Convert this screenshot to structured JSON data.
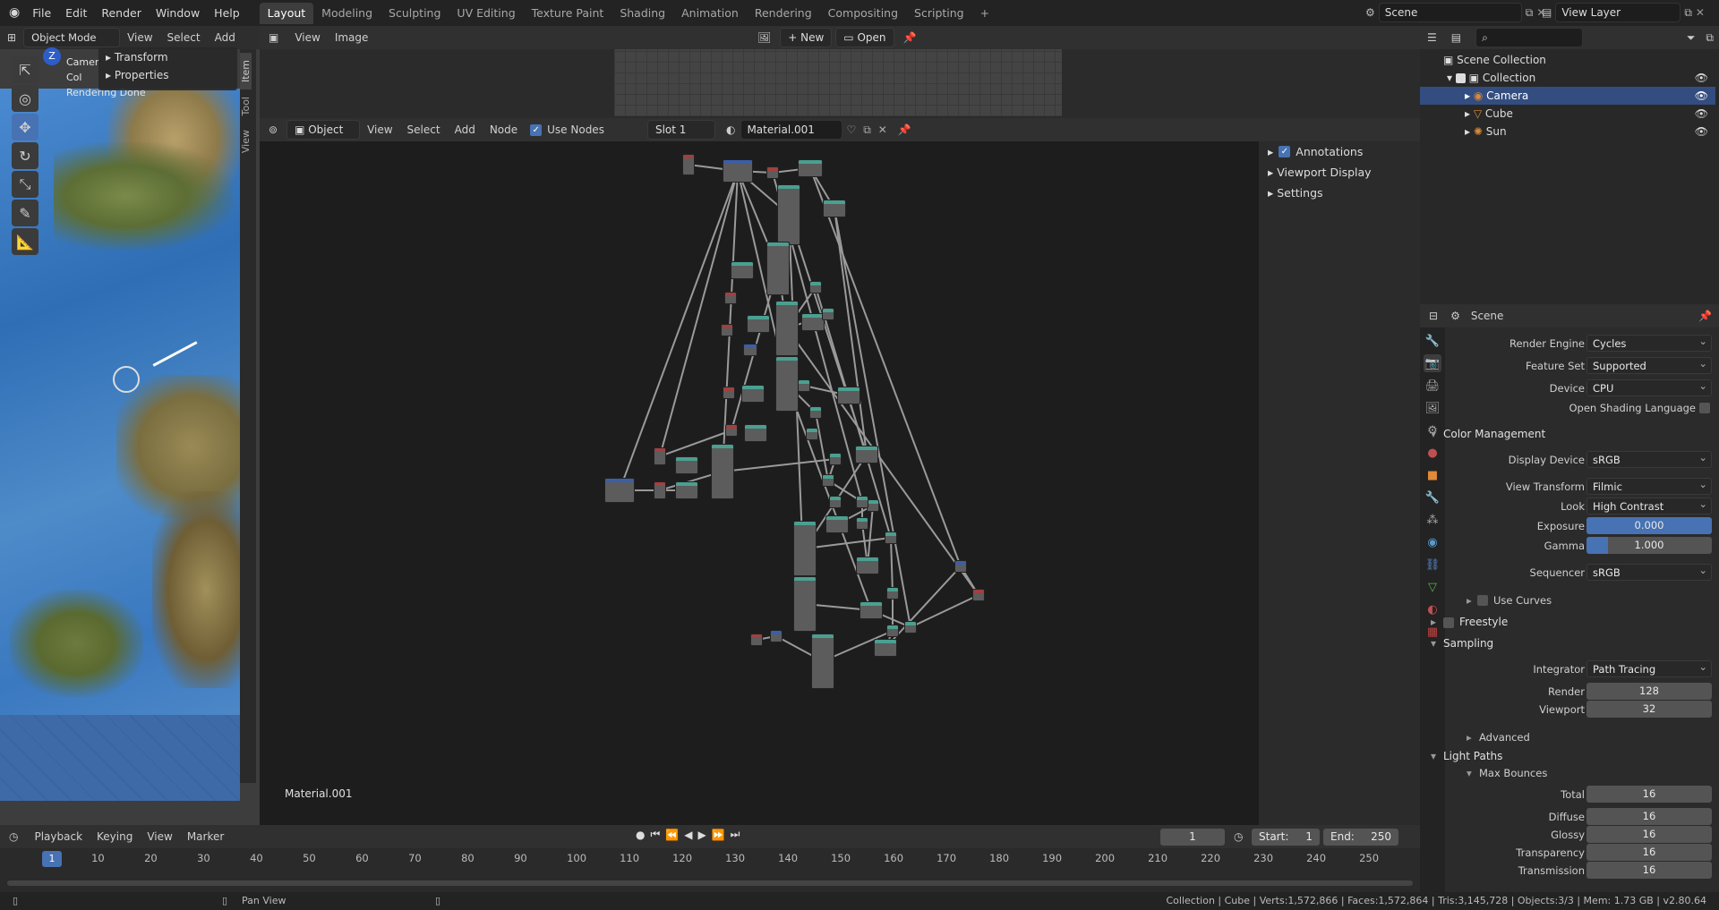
{
  "menus": [
    "File",
    "Edit",
    "Render",
    "Window",
    "Help"
  ],
  "workspaces": [
    "Layout",
    "Modeling",
    "Sculpting",
    "UV Editing",
    "Texture Paint",
    "Shading",
    "Animation",
    "Rendering",
    "Compositing",
    "Scripting"
  ],
  "active_workspace": "Layout",
  "scene_field": "Scene",
  "view_layer_field": "View Layer",
  "viewport": {
    "mode": "Object Mode",
    "menu": [
      "View",
      "Select",
      "Add"
    ],
    "n_panel": {
      "transform": "Transform",
      "properties": "Properties"
    },
    "side_tabs": [
      "Item",
      "Tool",
      "View"
    ],
    "overlay_lines": [
      "Camer",
      "Col",
      "Rendering Done"
    ],
    "axis_z": "Z"
  },
  "image_editor": {
    "menu": [
      "View",
      "Image"
    ],
    "new_label": "New",
    "open_label": "Open"
  },
  "node_editor": {
    "type": "Object",
    "menu": [
      "View",
      "Select",
      "Add",
      "Node"
    ],
    "use_nodes_label": "Use Nodes",
    "slot": "Slot 1",
    "material": "Material.001",
    "footer_label": "Material.001",
    "sidebar": {
      "annotations": "Annotations",
      "viewport_display": "Viewport Display",
      "settings": "Settings"
    }
  },
  "outliner": {
    "scene_collection": "Scene Collection",
    "collection": "Collection",
    "items": [
      {
        "name": "Camera",
        "color": "#d98a3a"
      },
      {
        "name": "Cube",
        "color": "#d98a3a"
      },
      {
        "name": "Sun",
        "color": "#d98a3a"
      }
    ]
  },
  "properties": {
    "header_title": "Scene",
    "render_engine": {
      "label": "Render Engine",
      "value": "Cycles"
    },
    "feature_set": {
      "label": "Feature Set",
      "value": "Supported"
    },
    "device": {
      "label": "Device",
      "value": "CPU"
    },
    "osl": "Open Shading Language",
    "color_management": "Color Management",
    "display_device": {
      "label": "Display Device",
      "value": "sRGB"
    },
    "view_transform": {
      "label": "View Transform",
      "value": "Filmic"
    },
    "look": {
      "label": "Look",
      "value": "High Contrast"
    },
    "exposure": {
      "label": "Exposure",
      "value": "0.000"
    },
    "gamma": {
      "label": "Gamma",
      "value": "1.000"
    },
    "sequencer": {
      "label": "Sequencer",
      "value": "sRGB"
    },
    "use_curves": "Use Curves",
    "freestyle": "Freestyle",
    "sampling": "Sampling",
    "integrator": {
      "label": "Integrator",
      "value": "Path Tracing"
    },
    "render": {
      "label": "Render",
      "value": "128"
    },
    "viewport_samples": {
      "label": "Viewport",
      "value": "32"
    },
    "advanced": "Advanced",
    "light_paths": "Light Paths",
    "max_bounces": "Max Bounces",
    "total": {
      "label": "Total",
      "value": "16"
    },
    "diffuse": {
      "label": "Diffuse",
      "value": "16"
    },
    "glossy": {
      "label": "Glossy",
      "value": "16"
    },
    "transparency": {
      "label": "Transparency",
      "value": "16"
    },
    "transmission": {
      "label": "Transmission",
      "value": "16"
    }
  },
  "timeline": {
    "menu": [
      "Playback",
      "Keying",
      "View",
      "Marker"
    ],
    "current_frame": "1",
    "start_label": "Start:",
    "start": "1",
    "end_label": "End:",
    "end": "250",
    "ticks": [
      "1",
      "10",
      "20",
      "30",
      "40",
      "50",
      "60",
      "70",
      "80",
      "90",
      "100",
      "110",
      "120",
      "130",
      "140",
      "150",
      "160",
      "170",
      "180",
      "190",
      "200",
      "210",
      "220",
      "230",
      "240",
      "250"
    ]
  },
  "status": {
    "left": "Pan View",
    "right": "Collection | Cube | Verts:1,572,866 | Faces:1,572,864 | Tris:3,145,728 | Objects:3/3 | Mem: 1.73 GB | v2.80.64"
  },
  "colors": {
    "accent": "#4772b3",
    "selection": "#334d80",
    "header": "#303030",
    "bg": "#232323"
  }
}
